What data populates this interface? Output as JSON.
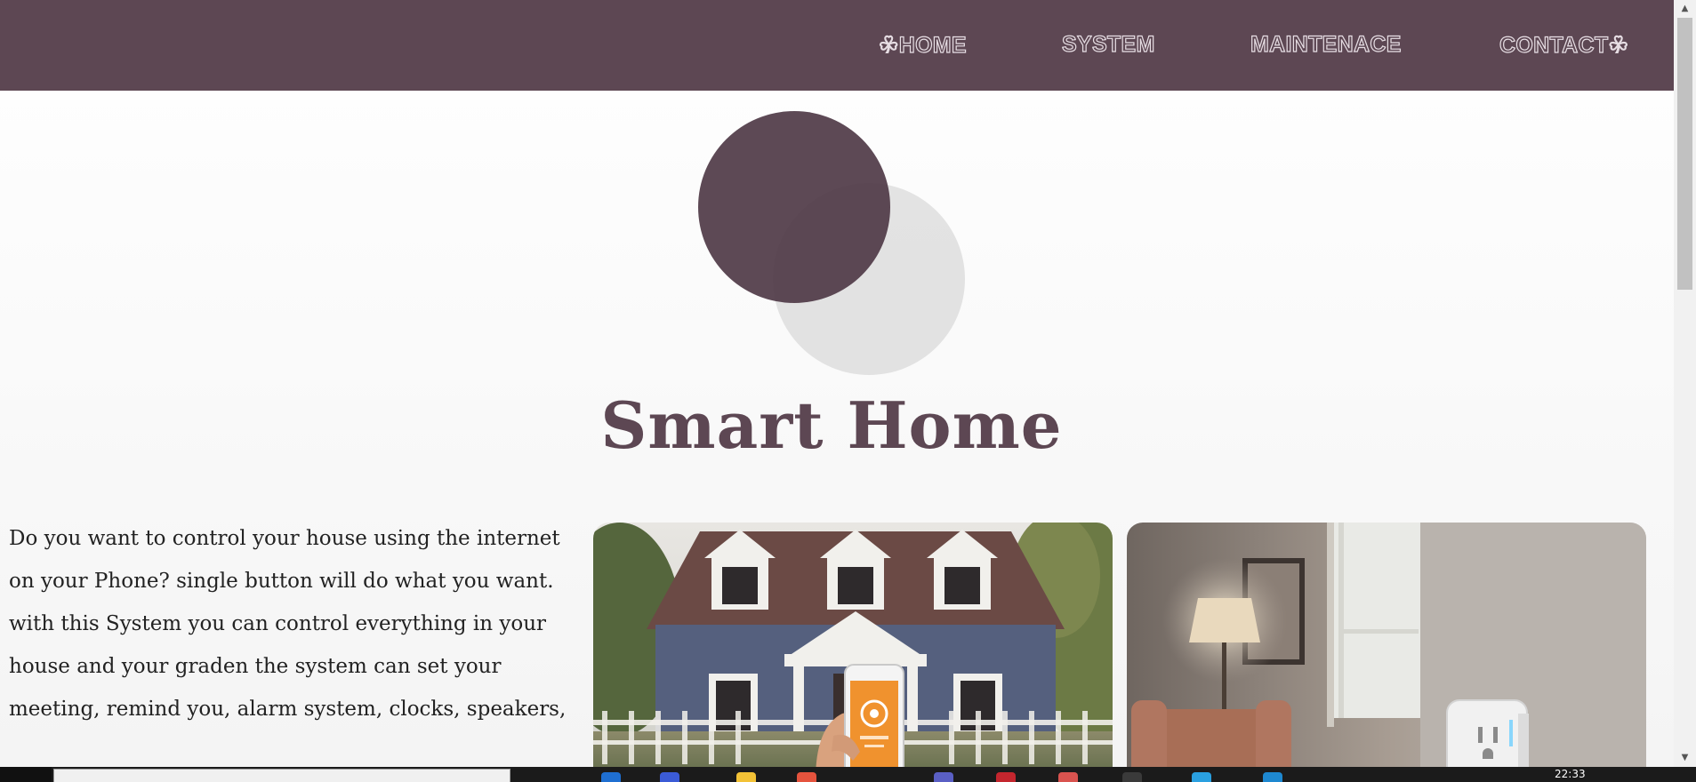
{
  "nav": {
    "home": "☘HOME",
    "system": "SYSTEM",
    "maintenance": "MAINTENACE",
    "contact": "CONTACT☘"
  },
  "hero": {
    "title": "Smart Home"
  },
  "intro": {
    "paragraph_1": "Do you want to control your house using the internet on your Phone? single button will do what you want.",
    "paragraph_2": "with this System you can control everything in your house and your graden the system can set your meeting, remind you, alarm system, clocks, speakers,"
  },
  "taskbar": {
    "clock": "22:33"
  },
  "colors": {
    "brand": "#5d4753",
    "accent_dark": "#4f3946",
    "accent_light": "#dcdcdc",
    "phone_app": "#f0922e"
  }
}
